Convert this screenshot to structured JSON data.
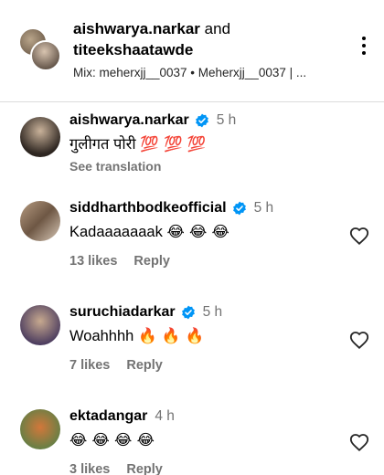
{
  "header": {
    "author1": "aishwarya.narkar",
    "and_word": "and",
    "author2": "titeekshaatawde",
    "music": "Mix: meherxjj__0037 • Meherxjj__0037 | ..."
  },
  "icons": {
    "more": "more-options-icon",
    "verified": "verified-badge-icon",
    "like": "heart-outline-icon"
  },
  "colors": {
    "verified": "#0095f6",
    "secondary_text": "#737373",
    "divider": "#dbdbdb"
  },
  "comments": [
    {
      "username": "aishwarya.narkar",
      "verified": true,
      "time": "5 h",
      "text": "गुलीगत पोरी",
      "emojis": "💯 💯 💯",
      "see_translation": "See translation"
    },
    {
      "username": "siddharthbodkeofficial",
      "verified": true,
      "time": "5 h",
      "text": "Kadaaaaaaak",
      "emojis": "😂 😂 😂",
      "likes": "13 likes",
      "reply": "Reply"
    },
    {
      "username": "suruchiadarkar",
      "verified": true,
      "time": "5 h",
      "text": "Woahhhh",
      "emojis": "🔥 🔥 🔥",
      "likes": "7 likes",
      "reply": "Reply"
    },
    {
      "username": "ektadangar",
      "verified": false,
      "time": "4 h",
      "text": "",
      "emojis": "😂 😂 😂 😂",
      "likes": "3 likes",
      "reply": "Reply"
    }
  ]
}
